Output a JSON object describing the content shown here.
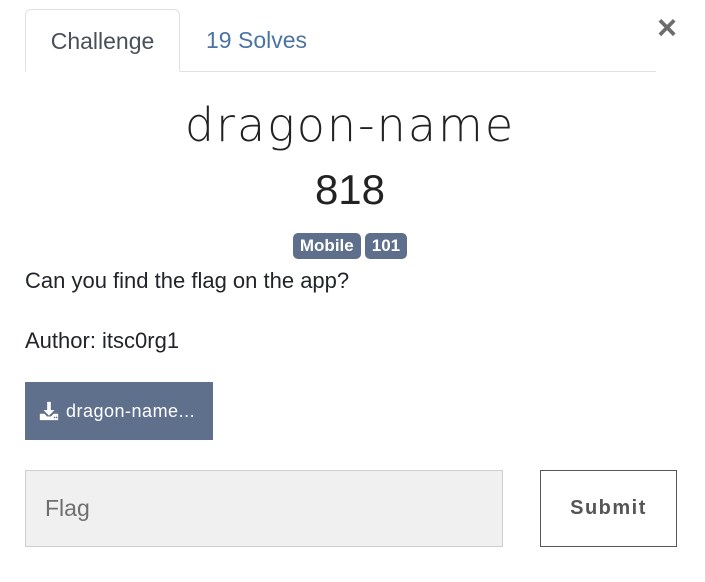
{
  "tabs": [
    {
      "label": "Challenge",
      "active": true
    },
    {
      "label": "19 Solves",
      "active": false
    }
  ],
  "close": {
    "label": "×",
    "icon": "close-icon"
  },
  "challenge": {
    "name": "dragon-name",
    "points": "818",
    "tags": [
      "Mobile",
      "101"
    ],
    "description": "Can you find the flag on the app?",
    "author": "Author: itsc0rg1",
    "file_label": "dragon-name...",
    "file_icon": "download-icon"
  },
  "form": {
    "flag_placeholder": "Flag",
    "flag_value": "",
    "submit_label": "Submit"
  },
  "colors": {
    "badge": "#5e6f8b",
    "download_button": "#5e708c",
    "tab_link": "#4b74a3"
  }
}
